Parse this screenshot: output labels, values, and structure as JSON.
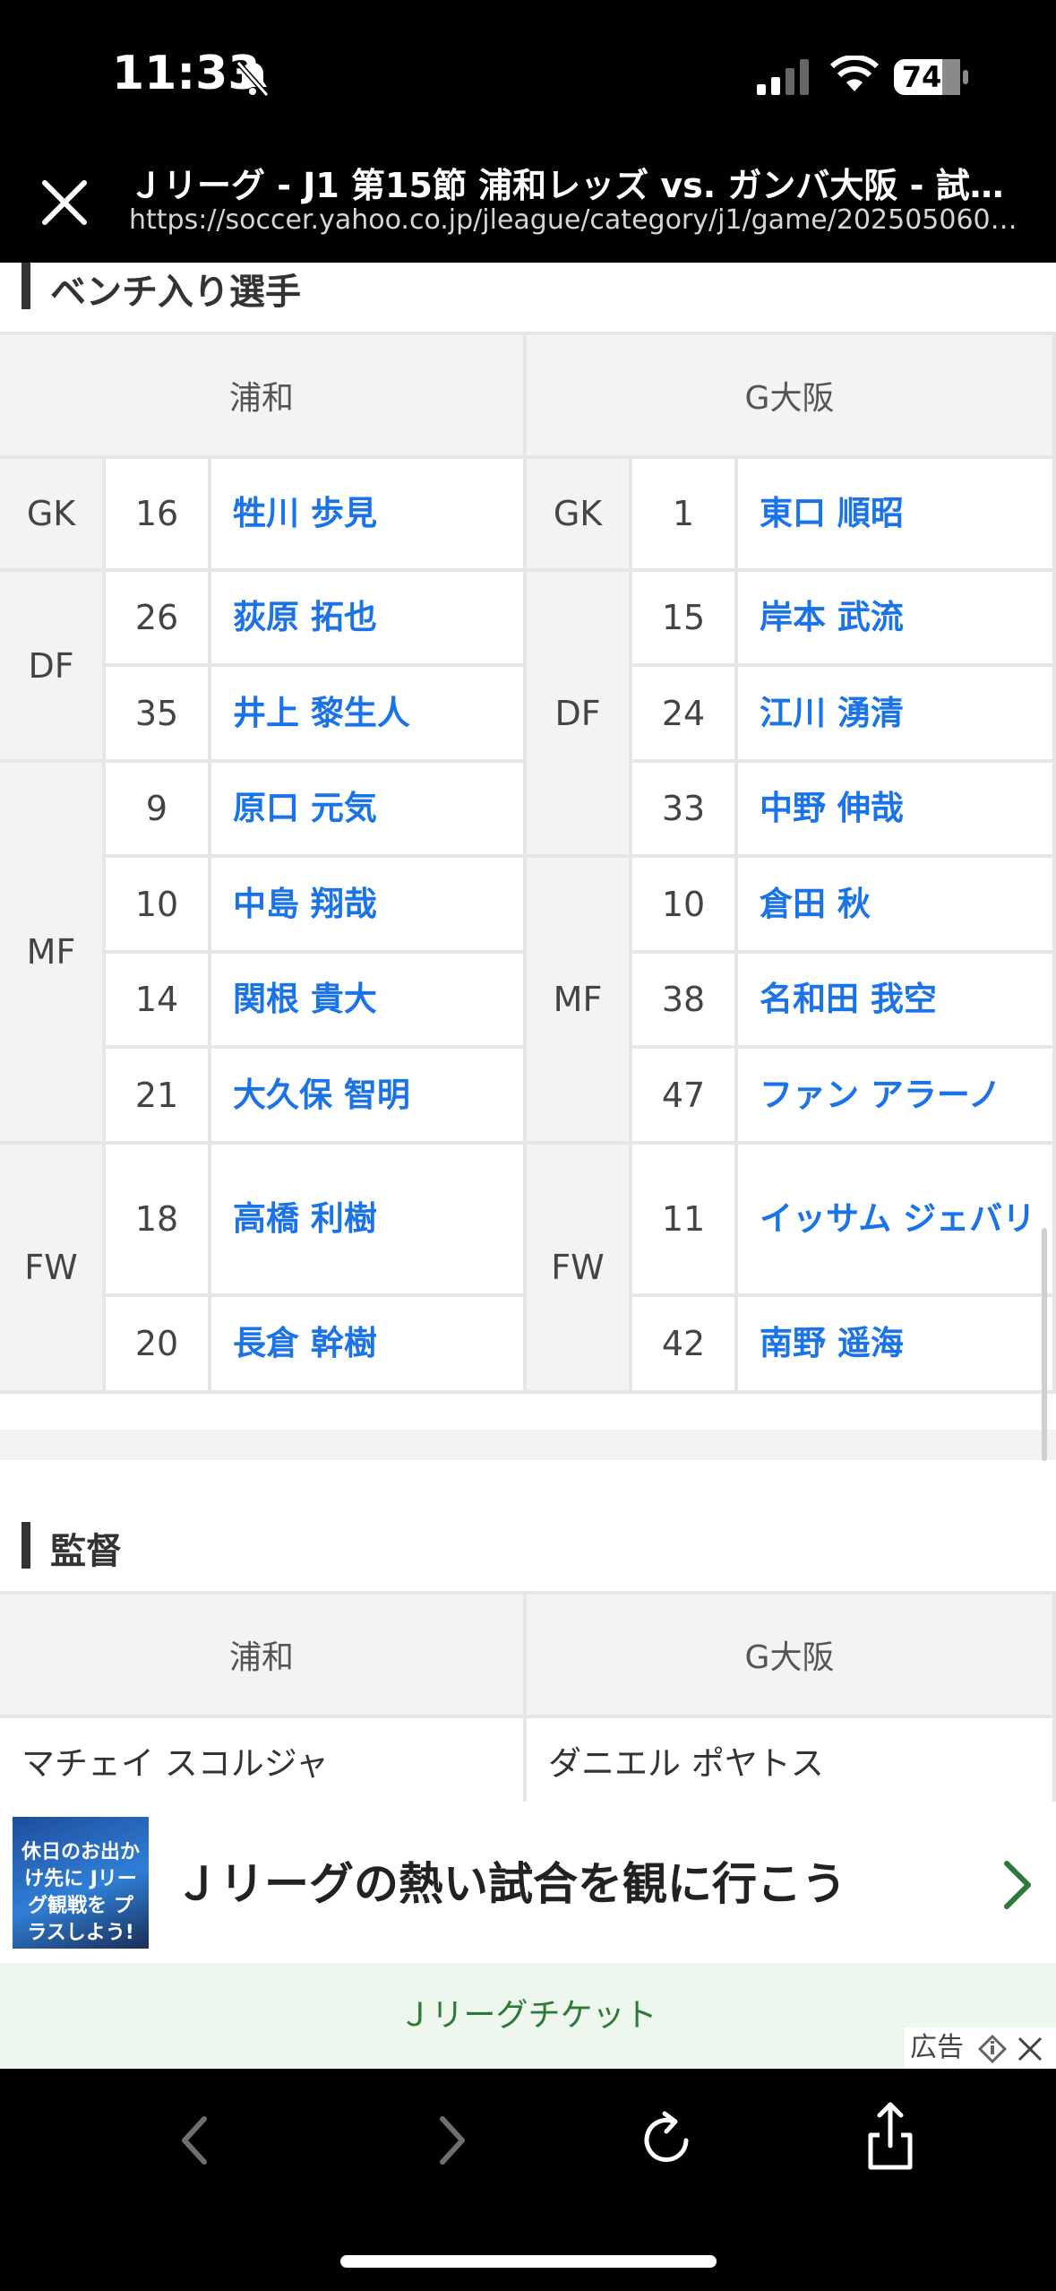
{
  "status": {
    "time": "11:33",
    "battery": "74"
  },
  "browser": {
    "title": "Ｊリーグ - J1 第15節 浦和レッズ vs. ガンバ大阪 - 試…",
    "url": "https://soccer.yahoo.co.jp/jleague/category/j1/game/2025050601/…"
  },
  "bench": {
    "heading": "ベンチ入り選手",
    "home_team": "浦和",
    "away_team": "G大阪",
    "home": [
      {
        "pos": "GK",
        "num": "16",
        "name": "牲川 歩見"
      },
      {
        "pos": "DF",
        "num": "26",
        "name": "荻原 拓也"
      },
      {
        "pos": "DF",
        "num": "35",
        "name": "井上 黎生人"
      },
      {
        "pos": "MF",
        "num": "9",
        "name": "原口 元気"
      },
      {
        "pos": "MF",
        "num": "10",
        "name": "中島 翔哉"
      },
      {
        "pos": "MF",
        "num": "14",
        "name": "関根 貴大"
      },
      {
        "pos": "MF",
        "num": "21",
        "name": "大久保 智明"
      },
      {
        "pos": "FW",
        "num": "18",
        "name": "高橋 利樹"
      },
      {
        "pos": "FW",
        "num": "20",
        "name": "長倉 幹樹"
      }
    ],
    "away": [
      {
        "pos": "GK",
        "num": "1",
        "name": "東口 順昭"
      },
      {
        "pos": "DF",
        "num": "15",
        "name": "岸本 武流"
      },
      {
        "pos": "DF",
        "num": "24",
        "name": "江川 湧清"
      },
      {
        "pos": "DF",
        "num": "33",
        "name": "中野 伸哉"
      },
      {
        "pos": "MF",
        "num": "10",
        "name": "倉田 秋"
      },
      {
        "pos": "MF",
        "num": "38",
        "name": "名和田 我空"
      },
      {
        "pos": "MF",
        "num": "47",
        "name": "ファン アラーノ"
      },
      {
        "pos": "FW",
        "num": "11",
        "name": "イッサム ジェバリ"
      },
      {
        "pos": "FW",
        "num": "42",
        "name": "南野 遥海"
      }
    ]
  },
  "manager": {
    "heading": "監督",
    "home_team": "浦和",
    "away_team": "G大阪",
    "home": "マチェイ スコルジャ",
    "away": "ダニエル ポヤトス"
  },
  "ad": {
    "title": "Ｊリーグの熱い試合を観に行こう",
    "cta": "Ｊリーグチケット",
    "label": "広告",
    "thumb_text": "休日のお出かけ先に Jリーグ観戦を プラスしよう!"
  },
  "icons": {
    "bell": "bell-slash-icon",
    "close": "close-icon",
    "back": "chevron-left-icon",
    "forward": "chevron-right-icon",
    "reload": "reload-icon",
    "share": "share-icon"
  }
}
